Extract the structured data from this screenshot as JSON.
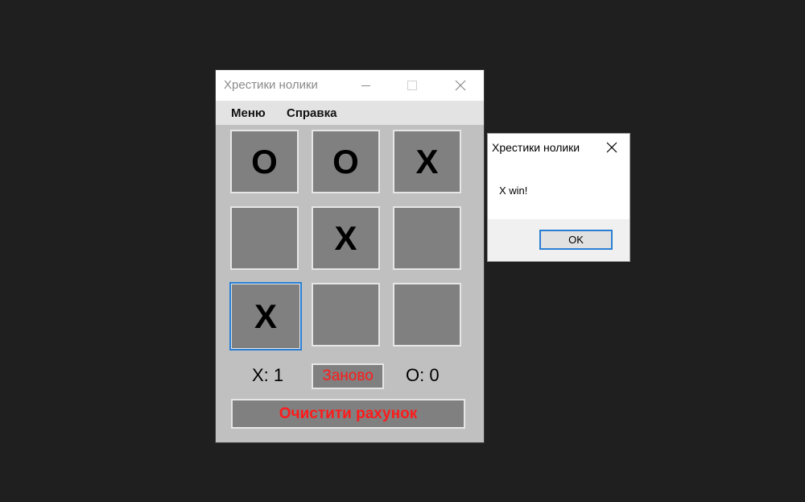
{
  "window": {
    "title": "Хрестики нолики"
  },
  "menu": {
    "items": [
      "Меню",
      "Справка"
    ]
  },
  "board": {
    "cells": [
      "O",
      "O",
      "X",
      "",
      "X",
      "",
      "X",
      "",
      ""
    ]
  },
  "score": {
    "x_text": "X: 1",
    "o_text": "O: 0"
  },
  "buttons": {
    "restart": "Заново",
    "clear_score": "Очистити рахунок"
  },
  "dialog": {
    "title": "Хрестики нолики",
    "message": "X win!",
    "ok_label": "OK"
  },
  "colors": {
    "background": "#1f1f1f",
    "window_body": "#c0c0c0",
    "cell": "#808080",
    "accent_red": "#ff1a1a",
    "focus_blue": "#2a7fd4"
  },
  "icons": {
    "minimize": "minimize-icon",
    "maximize": "maximize-icon",
    "close": "close-icon"
  }
}
